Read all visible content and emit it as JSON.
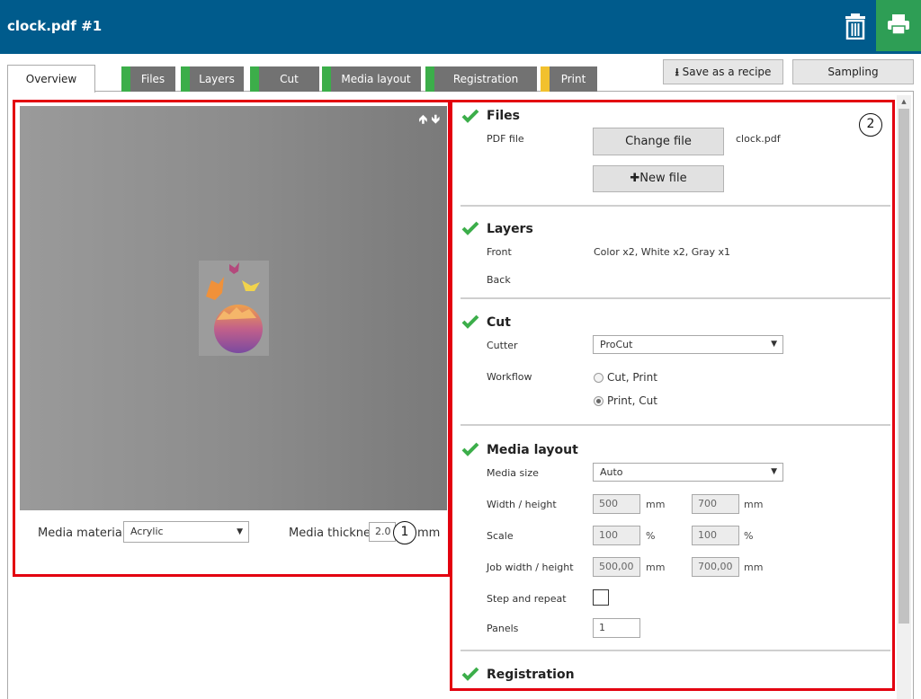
{
  "window": {
    "title": "clock.pdf #1"
  },
  "tabs": [
    {
      "label": "Overview",
      "status_color": ""
    },
    {
      "label": "Files",
      "status_color": "#3cae4a"
    },
    {
      "label": "Layers",
      "status_color": "#3cae4a"
    },
    {
      "label": "Cut",
      "status_color": "#3cae4a"
    },
    {
      "label": "Media layout",
      "status_color": "#3cae4a"
    },
    {
      "label": "Registration",
      "status_color": "#3cae4a"
    },
    {
      "label": "Print",
      "status_color": "#f2c12e"
    }
  ],
  "toolbar": {
    "save_recipe_label": "Save as a recipe",
    "sampling_label": "Sampling"
  },
  "preview": {
    "media_material_label": "Media material",
    "media_material_value": "Acrylic",
    "media_thickness_label": "Media thickness",
    "media_thickness_value": "2.0",
    "media_thickness_unit": "mm",
    "callout": "1"
  },
  "settings": {
    "callout": "2",
    "files": {
      "title": "Files",
      "pdf_label": "PDF file",
      "change_label": "Change file",
      "filename": "clock.pdf",
      "new_label": "New file"
    },
    "layers": {
      "title": "Layers",
      "front_label": "Front",
      "front_value": "Color x2, White x2, Gray x1",
      "back_label": "Back"
    },
    "cut": {
      "title": "Cut",
      "cutter_label": "Cutter",
      "cutter_value": "ProCut",
      "workflow_label": "Workflow",
      "options": [
        "Cut, Print",
        "Print, Cut"
      ],
      "selected": "Print, Cut"
    },
    "media_layout": {
      "title": "Media layout",
      "size_label": "Media size",
      "size_value": "Auto",
      "wh_label": "Width / height",
      "width": "500",
      "height": "700",
      "unit_mm": "mm",
      "scale_label": "Scale",
      "scale_x": "100",
      "scale_y": "100",
      "unit_pct": "%",
      "job_label": "Job width / height",
      "job_width": "500,00",
      "job_height": "700,00",
      "step_label": "Step and repeat",
      "step_checked": false,
      "panels_label": "Panels",
      "panels_value": "1"
    },
    "registration": {
      "title": "Registration"
    }
  },
  "colors": {
    "titlebar": "#005b8c",
    "print_button": "#2e9e55",
    "highlight_border": "#e3000f",
    "check": "#3cae4a"
  }
}
